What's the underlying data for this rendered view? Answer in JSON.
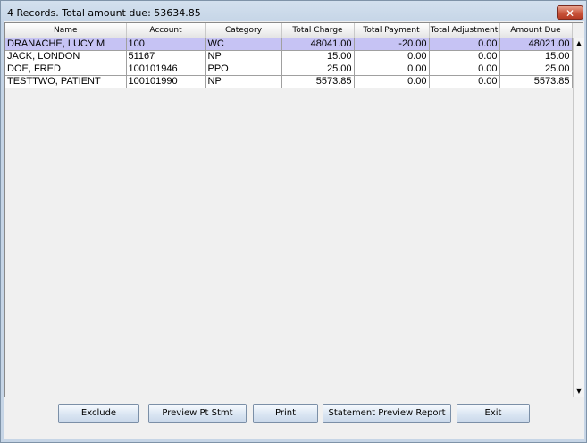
{
  "window": {
    "title": "4 Records. Total amount due: 53634.85",
    "close_glyph": "✕"
  },
  "table": {
    "columns": [
      "Name",
      "Account",
      "Category",
      "Total Charge",
      "Total Payment",
      "Total Adjustment",
      "Amount Due"
    ],
    "rows": [
      {
        "name": "DRANACHE, LUCY M",
        "account": "100",
        "category": "WC",
        "total_charge": "48041.00",
        "total_payment": "-20.00",
        "total_adjustment": "0.00",
        "amount_due": "48021.00",
        "selected": true
      },
      {
        "name": "JACK, LONDON",
        "account": "51167",
        "category": "NP",
        "total_charge": "15.00",
        "total_payment": "0.00",
        "total_adjustment": "0.00",
        "amount_due": "15.00",
        "selected": false
      },
      {
        "name": "DOE, FRED",
        "account": "100101946",
        "category": "PPO",
        "total_charge": "25.00",
        "total_payment": "0.00",
        "total_adjustment": "0.00",
        "amount_due": "25.00",
        "selected": false
      },
      {
        "name": "TESTTWO, PATIENT",
        "account": "100101990",
        "category": "NP",
        "total_charge": "5573.85",
        "total_payment": "0.00",
        "total_adjustment": "0.00",
        "amount_due": "5573.85",
        "selected": false
      }
    ]
  },
  "scrollbar": {
    "up_glyph": "▲",
    "down_glyph": "▼"
  },
  "buttons": {
    "exclude": "Exclude",
    "preview_pt_stmt": "Preview Pt Stmt",
    "print": "Print",
    "statement_preview_report": "Statement Preview Report",
    "exit": "Exit"
  },
  "colors": {
    "selected_row": "#c6c3f4",
    "close_button": "#c8543b"
  }
}
